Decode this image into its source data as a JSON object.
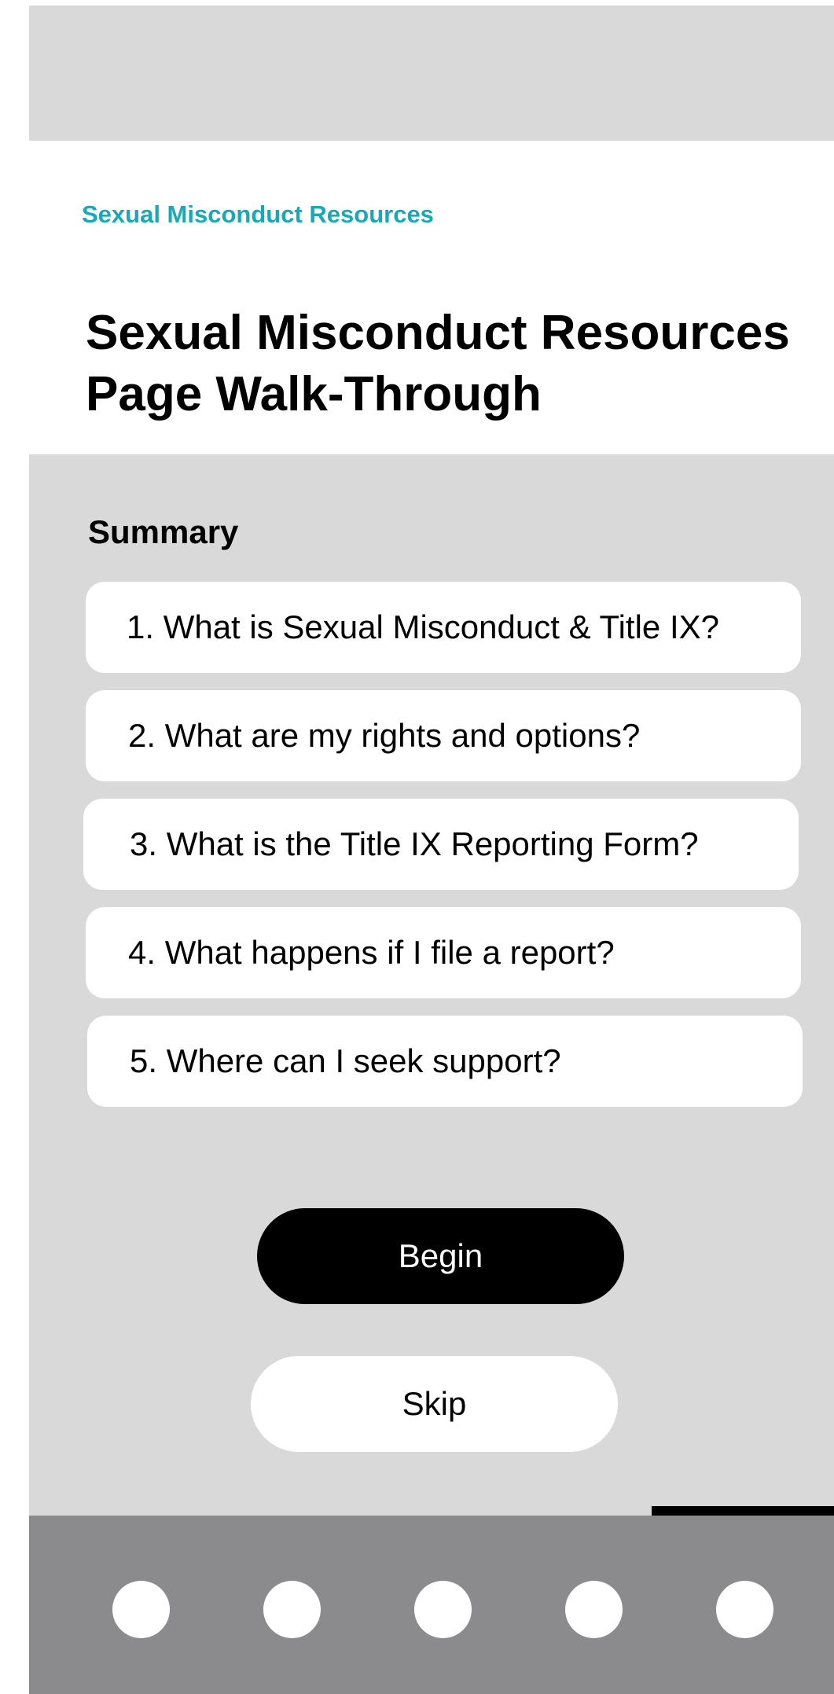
{
  "header": {
    "breadcrumb": "Sexual Misconduct Resources",
    "title_line1": "Sexual Misconduct Resources",
    "title_line2": "Page Walk-Through"
  },
  "summary": {
    "heading": "Summary",
    "items": [
      {
        "label": "1. What is Sexual Misconduct & Title IX?"
      },
      {
        "label": "2. What are my rights and options?"
      },
      {
        "label": "3. What is the Title IX Reporting Form?"
      },
      {
        "label": "4. What happens if I file a report?"
      },
      {
        "label": "5. Where can I seek support?"
      }
    ]
  },
  "actions": {
    "begin_label": "Begin",
    "skip_label": "Skip"
  },
  "bottom_nav": {
    "dots": [
      "nav-dot-1",
      "nav-dot-2",
      "nav-dot-3",
      "nav-dot-4",
      "nav-dot-5"
    ]
  },
  "colors": {
    "accent": "#17a9b5",
    "panel_background": "#d9d9d9",
    "nav_background": "#8b8a8c",
    "primary_button": "#000000"
  }
}
